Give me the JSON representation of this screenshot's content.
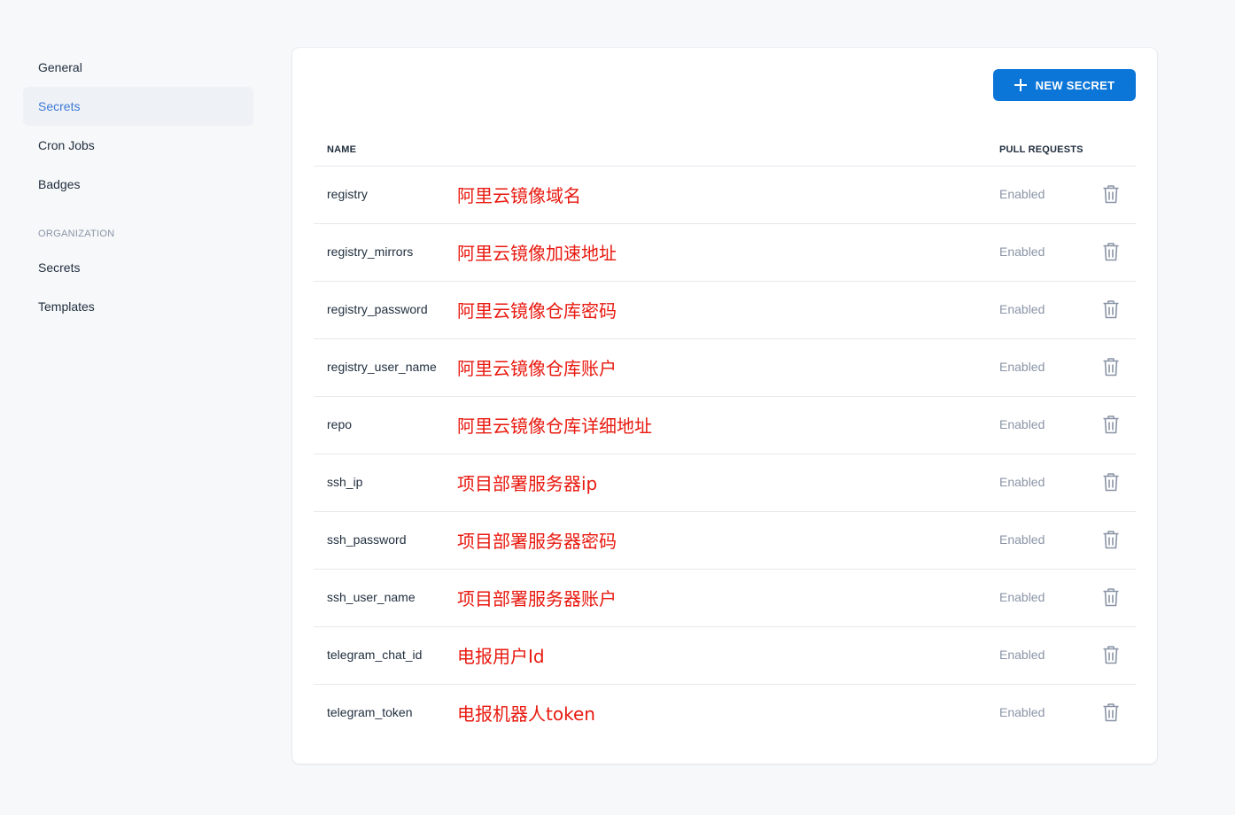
{
  "sidebar": {
    "items": [
      {
        "label": "General"
      },
      {
        "label": "Secrets"
      },
      {
        "label": "Cron Jobs"
      },
      {
        "label": "Badges"
      }
    ],
    "org_heading": "ORGANIZATION",
    "org_items": [
      {
        "label": "Secrets"
      },
      {
        "label": "Templates"
      }
    ]
  },
  "toolbar": {
    "new_secret_label": "NEW SECRET"
  },
  "table": {
    "headers": {
      "name": "NAME",
      "pull_requests": "PULL REQUESTS"
    },
    "rows": [
      {
        "name": "registry",
        "note": "阿里云镜像域名",
        "status": "Enabled"
      },
      {
        "name": "registry_mirrors",
        "note": "阿里云镜像加速地址",
        "status": "Enabled"
      },
      {
        "name": "registry_password",
        "note": "阿里云镜像仓库密码",
        "status": "Enabled"
      },
      {
        "name": "registry_user_name",
        "note": "阿里云镜像仓库账户",
        "status": "Enabled"
      },
      {
        "name": "repo",
        "note": "阿里云镜像仓库详细地址",
        "status": "Enabled"
      },
      {
        "name": "ssh_ip",
        "note": "项目部署服务器ip",
        "status": "Enabled"
      },
      {
        "name": "ssh_password",
        "note": "项目部署服务器密码",
        "status": "Enabled"
      },
      {
        "name": "ssh_user_name",
        "note": "项目部署服务器账户",
        "status": "Enabled"
      },
      {
        "name": "telegram_chat_id",
        "note": "电报用户Id",
        "status": "Enabled"
      },
      {
        "name": "telegram_token",
        "note": "电报机器人token",
        "status": "Enabled"
      }
    ]
  },
  "colors": {
    "accent": "#0b75d8",
    "active_nav_text": "#3d7ad6",
    "annotation": "#e8190f",
    "muted": "#8a94a6"
  }
}
